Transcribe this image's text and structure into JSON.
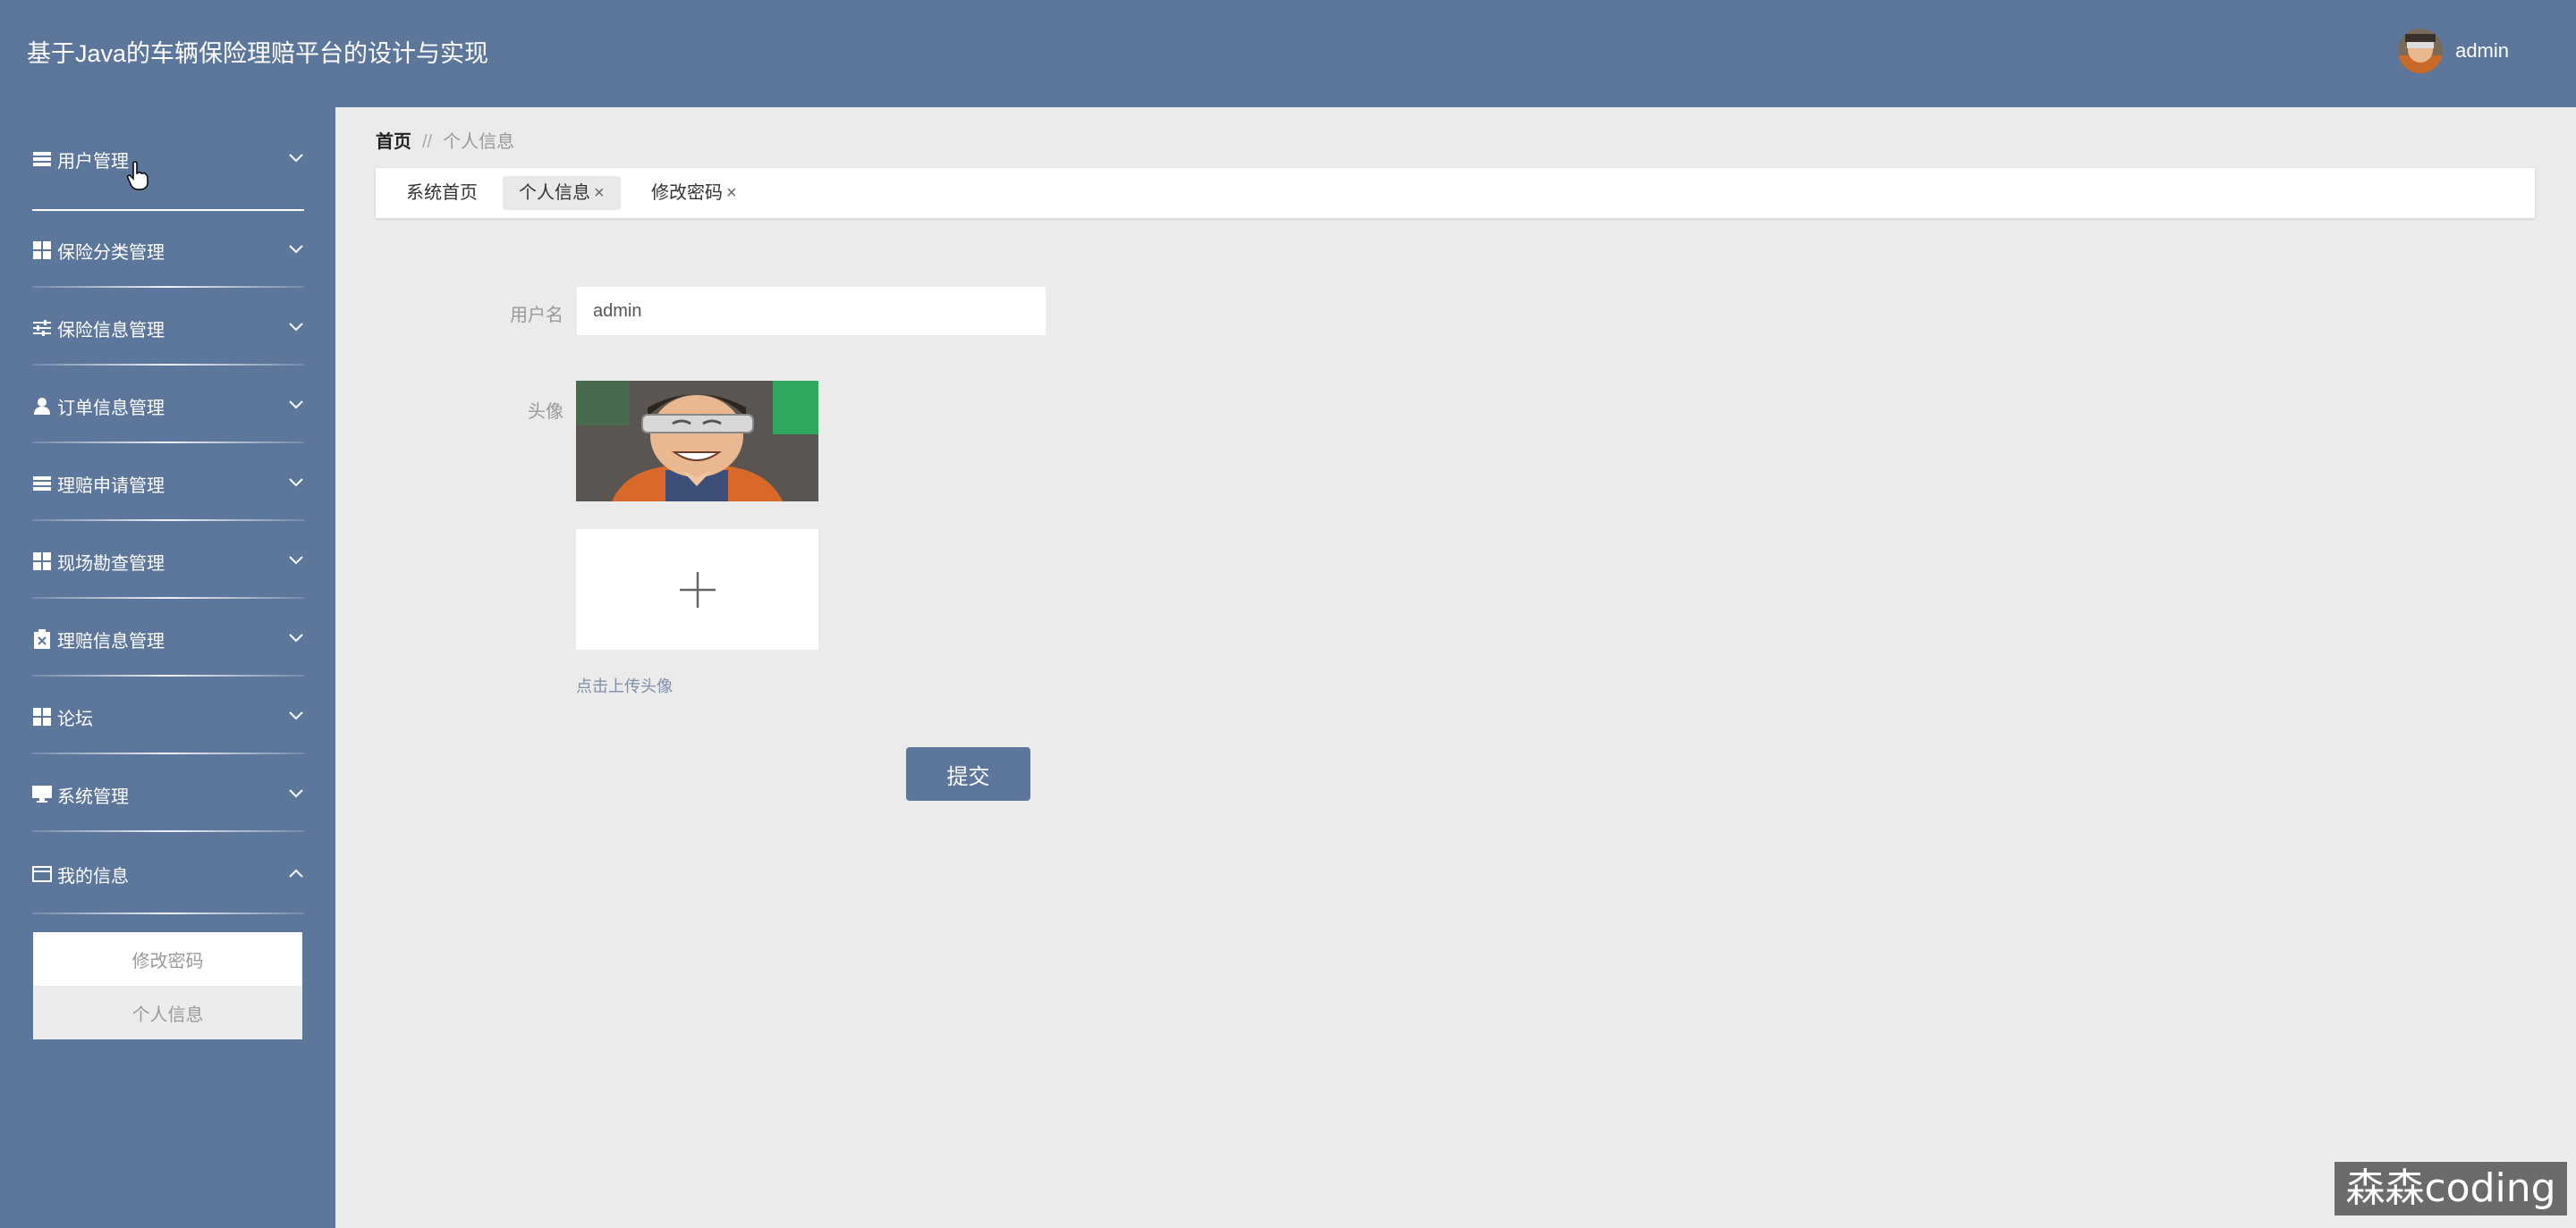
{
  "header": {
    "title": "基于Java的车辆保险理赔平台的设计与实现",
    "username": "admin"
  },
  "sidebar": {
    "items": [
      {
        "label": "用户管理",
        "icon": "list-icon"
      },
      {
        "label": "保险分类管理",
        "icon": "grid-icon"
      },
      {
        "label": "保险信息管理",
        "icon": "sliders-icon"
      },
      {
        "label": "订单信息管理",
        "icon": "user-icon"
      },
      {
        "label": "理赔申请管理",
        "icon": "list-icon"
      },
      {
        "label": "现场勘查管理",
        "icon": "grid-icon"
      },
      {
        "label": "理赔信息管理",
        "icon": "clipboard-icon"
      },
      {
        "label": "论坛",
        "icon": "grid-icon"
      },
      {
        "label": "系统管理",
        "icon": "monitor-icon"
      },
      {
        "label": "我的信息",
        "icon": "card-icon"
      }
    ],
    "submenu": [
      "修改密码",
      "个人信息"
    ]
  },
  "breadcrumb": {
    "home": "首页",
    "separator": "//",
    "current": "个人信息"
  },
  "tabs": [
    {
      "label": "系统首页"
    },
    {
      "label": "个人信息",
      "close": "×"
    },
    {
      "label": "修改密码",
      "close": "×"
    }
  ],
  "form": {
    "username_label": "用户名",
    "username_value": "admin",
    "avatar_label": "头像",
    "upload_tip": "点击上传头像",
    "submit_label": "提交"
  },
  "watermark": "森森coding",
  "colors": {
    "primary": "#5c769c",
    "background": "#ebebeb"
  }
}
